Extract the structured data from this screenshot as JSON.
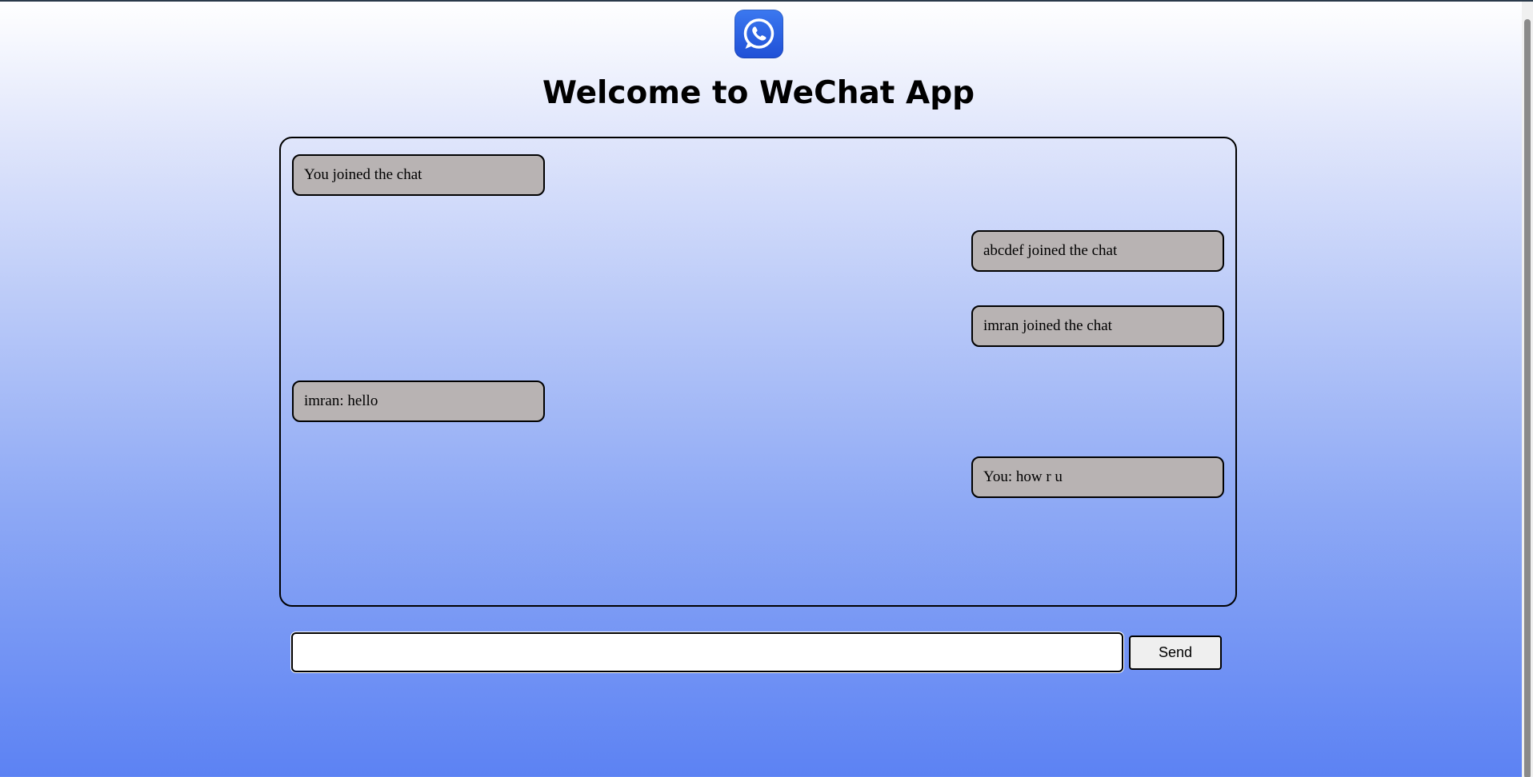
{
  "app": {
    "title": "Welcome to WeChat App",
    "logo_icon": "whatsapp-icon",
    "accent_color": "#1f4fd6"
  },
  "messages": [
    {
      "text": "You joined the chat",
      "side": "left"
    },
    {
      "text": "abcdef joined the chat",
      "side": "right"
    },
    {
      "text": "imran joined the chat",
      "side": "right"
    },
    {
      "text": "imran: hello",
      "side": "left"
    },
    {
      "text": "You: how r u",
      "side": "right"
    }
  ],
  "composer": {
    "value": "",
    "send_label": "Send"
  }
}
